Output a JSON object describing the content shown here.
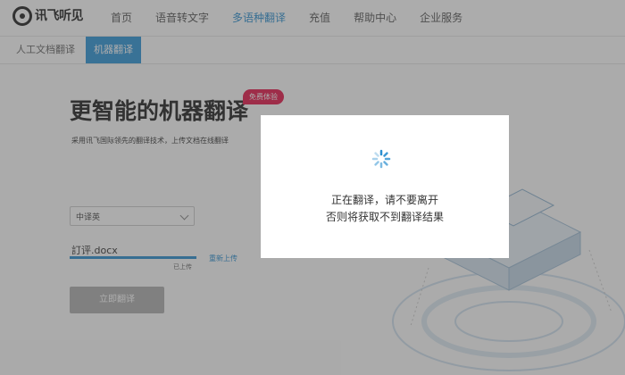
{
  "brand": {
    "name": "讯飞听见",
    "tagline": ""
  },
  "nav": {
    "items": [
      {
        "label": "首页",
        "active": false
      },
      {
        "label": "语音转文字",
        "active": false
      },
      {
        "label": "多语种翻译",
        "active": true
      },
      {
        "label": "充值",
        "active": false
      },
      {
        "label": "帮助中心",
        "active": false
      },
      {
        "label": "企业服务",
        "active": false
      }
    ]
  },
  "subtabs": [
    {
      "label": "人工文档翻译",
      "active": false
    },
    {
      "label": "机器翻译",
      "active": true
    }
  ],
  "hero": {
    "title": "更智能的机器翻译",
    "badge": "免费体验",
    "description": "采用讯飞国际领先的翻译技术，上传文档在线翻译"
  },
  "form": {
    "language": "中译英",
    "file_name": "訂评.docx",
    "file_date": "",
    "file_status": "已上传",
    "upload_progress": 1.0,
    "reupload_label": "重新上传",
    "submit_label": "立即翻译"
  },
  "modal": {
    "line1": "正在翻译，请不要离开",
    "line2": "否则将获取不到翻译结果",
    "icon": "loading-spinner-icon"
  },
  "colors": {
    "accent": "#2a8fd0",
    "badge": "#e6194b",
    "overlay": "rgba(70,70,70,0.45)"
  }
}
